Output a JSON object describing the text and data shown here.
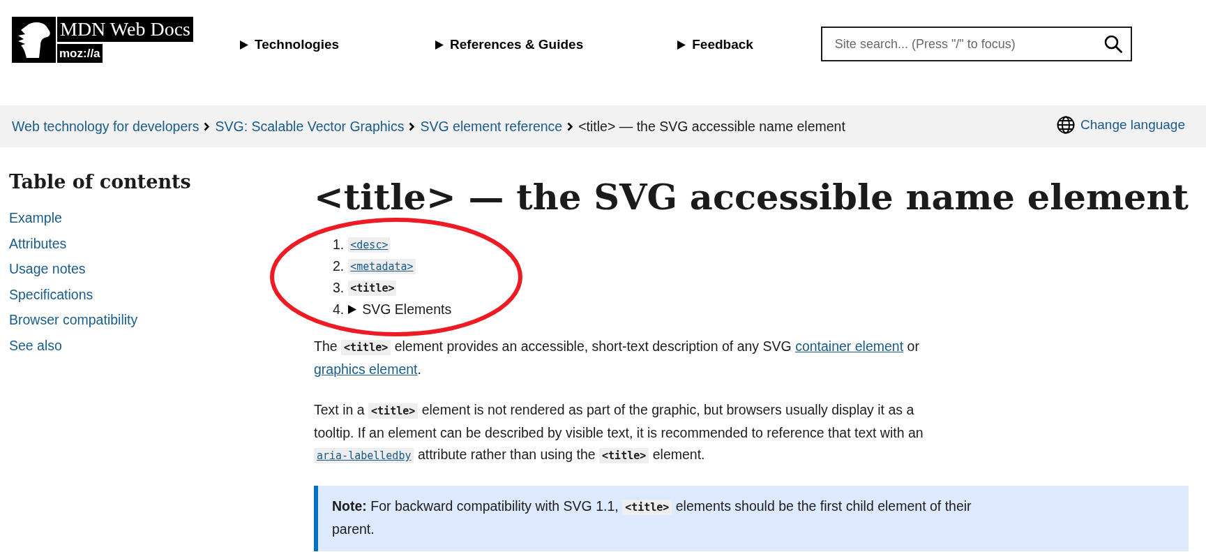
{
  "logo": {
    "wordmark": "MDN Web Docs",
    "brand": "moz://a"
  },
  "nav": [
    {
      "label": "Technologies",
      "expanded": false
    },
    {
      "label": "References & Guides",
      "expanded": false
    },
    {
      "label": "Feedback",
      "expanded": false
    }
  ],
  "search": {
    "placeholder": "Site search... (Press \"/\" to focus)"
  },
  "breadcrumbs": [
    {
      "label": "Web technology for developers",
      "kind": "link"
    },
    {
      "label": "SVG: Scalable Vector Graphics",
      "kind": "link"
    },
    {
      "label": "SVG element reference",
      "kind": "link"
    },
    {
      "label": "<title> — the SVG accessible name element",
      "kind": "current"
    }
  ],
  "language_button": "Change language",
  "sidebar": {
    "title": "Table of contents",
    "items": [
      "Example",
      "Attributes",
      "Usage notes",
      "Specifications",
      "Browser compatibility",
      "See also"
    ]
  },
  "article": {
    "title": "<title> — the SVG accessible name element",
    "related": [
      {
        "number": "1.",
        "kind": "code-link",
        "text": "<desc>"
      },
      {
        "number": "2.",
        "kind": "code-link",
        "text": "<metadata>"
      },
      {
        "number": "3.",
        "kind": "current",
        "text": "<title>"
      },
      {
        "number": "4.",
        "kind": "details",
        "text": "SVG Elements",
        "expanded": false
      }
    ],
    "paragraphs": [
      [
        {
          "kind": "text",
          "text": "The "
        },
        {
          "kind": "code",
          "text": "<title>"
        },
        {
          "kind": "text",
          "text": " element provides an accessible, short-text description of any SVG "
        },
        {
          "kind": "link",
          "text": "container element"
        },
        {
          "kind": "text",
          "text": " or "
        },
        {
          "kind": "link",
          "text": "graphics element"
        },
        {
          "kind": "text",
          "text": "."
        }
      ],
      [
        {
          "kind": "text",
          "text": "Text in a "
        },
        {
          "kind": "code",
          "text": "<title>"
        },
        {
          "kind": "text",
          "text": " element is not rendered as part of the graphic, but browsers usually display it as a tooltip. If an element can be described by visible text, it is recommended to reference that text with an "
        },
        {
          "kind": "code-link",
          "text": "aria-labelledby"
        },
        {
          "kind": "text",
          "text": " attribute rather than using the "
        },
        {
          "kind": "code",
          "text": "<title>"
        },
        {
          "kind": "text",
          "text": " element."
        }
      ]
    ],
    "note": [
      {
        "kind": "bold",
        "text": "Note:"
      },
      {
        "kind": "text",
        "text": " For backward compatibility with SVG 1.1, "
      },
      {
        "kind": "code",
        "text": "<title>"
      },
      {
        "kind": "text",
        "text": " elements should be the first child element of their parent."
      }
    ]
  }
}
